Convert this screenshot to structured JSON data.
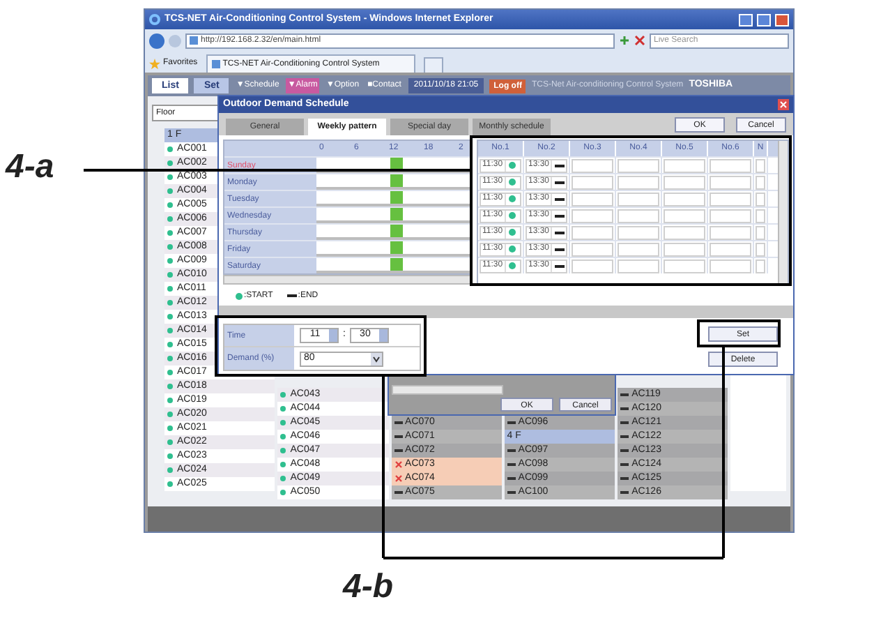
{
  "browser": {
    "title": "TCS-NET Air-Conditioning Control System - Windows Internet Explorer",
    "address": "http://192.168.2.32/en/main.html",
    "search_placeholder": "Live Search",
    "favorites": "Favorites",
    "tab": "TCS-NET Air-Conditioning Control System"
  },
  "app_nav": {
    "tabs": [
      {
        "label": "List",
        "selected": true
      },
      {
        "label": "Set",
        "selected": false
      }
    ],
    "menus": [
      {
        "label": "▼Schedule",
        "highlighted": false
      },
      {
        "label": "▼Alarm",
        "highlighted": true
      },
      {
        "label": "▼Option",
        "highlighted": false
      },
      {
        "label": "■Contact",
        "highlighted": false
      }
    ],
    "datetime": "2011/10/18 21:05",
    "logoff": "Log off",
    "system_name": "TCS-Net Air-conditioning Control System",
    "brand": "TOSHIBA"
  },
  "floor_field": {
    "value": "Floor"
  },
  "unit_columns": [
    {
      "items": [
        {
          "kind": "header",
          "label": "1 F"
        },
        {
          "kind": "running",
          "label": "AC001"
        },
        {
          "kind": "running",
          "label": "AC002"
        },
        {
          "kind": "running",
          "label": "AC003"
        },
        {
          "kind": "running",
          "label": "AC004"
        },
        {
          "kind": "running",
          "label": "AC005"
        },
        {
          "kind": "running",
          "label": "AC006"
        },
        {
          "kind": "running",
          "label": "AC007"
        },
        {
          "kind": "running",
          "label": "AC008"
        },
        {
          "kind": "running",
          "label": "AC009"
        },
        {
          "kind": "running",
          "label": "AC010"
        },
        {
          "kind": "running",
          "label": "AC011"
        },
        {
          "kind": "running",
          "label": "AC012"
        },
        {
          "kind": "running",
          "label": "AC013"
        },
        {
          "kind": "running",
          "label": "AC014"
        },
        {
          "kind": "running",
          "label": "AC015"
        },
        {
          "kind": "running",
          "label": "AC016"
        },
        {
          "kind": "running",
          "label": "AC017"
        },
        {
          "kind": "running",
          "label": "AC018"
        },
        {
          "kind": "running",
          "label": "AC019"
        },
        {
          "kind": "running",
          "label": "AC020"
        },
        {
          "kind": "running",
          "label": "AC021"
        },
        {
          "kind": "running",
          "label": "AC022"
        },
        {
          "kind": "running",
          "label": "AC023"
        },
        {
          "kind": "running",
          "label": "AC024"
        },
        {
          "kind": "running",
          "label": "AC025"
        }
      ]
    },
    {
      "items": [
        {
          "kind": "running",
          "label": "AC043"
        },
        {
          "kind": "running",
          "label": "AC044"
        },
        {
          "kind": "running",
          "label": "AC045"
        },
        {
          "kind": "running",
          "label": "AC046"
        },
        {
          "kind": "running",
          "label": "AC047"
        },
        {
          "kind": "running",
          "label": "AC048"
        },
        {
          "kind": "running",
          "label": "AC049"
        },
        {
          "kind": "running",
          "label": "AC050"
        }
      ]
    },
    {
      "items": [
        {
          "kind": "stopped",
          "label": "AC070"
        },
        {
          "kind": "stopped",
          "label": "AC071"
        },
        {
          "kind": "stopped",
          "label": "AC072"
        },
        {
          "kind": "fault",
          "label": "AC073"
        },
        {
          "kind": "fault",
          "label": "AC074"
        },
        {
          "kind": "stopped",
          "label": "AC075"
        }
      ]
    },
    {
      "items": [
        {
          "kind": "stopped",
          "label": "AC096"
        },
        {
          "kind": "header",
          "label": "4 F"
        },
        {
          "kind": "stopped",
          "label": "AC097"
        },
        {
          "kind": "stopped",
          "label": "AC098"
        },
        {
          "kind": "stopped",
          "label": "AC099"
        },
        {
          "kind": "stopped",
          "label": "AC100"
        }
      ]
    },
    {
      "items": [
        {
          "kind": "stopped",
          "label": "AC119"
        },
        {
          "kind": "stopped",
          "label": "AC120"
        },
        {
          "kind": "stopped",
          "label": "AC121"
        },
        {
          "kind": "stopped",
          "label": "AC122"
        },
        {
          "kind": "stopped",
          "label": "AC123"
        },
        {
          "kind": "stopped",
          "label": "AC124"
        },
        {
          "kind": "stopped",
          "label": "AC125"
        },
        {
          "kind": "stopped",
          "label": "AC126"
        }
      ]
    }
  ],
  "mini_dialog": {
    "buttons": [
      "OK",
      "Cancel"
    ]
  },
  "dialog": {
    "title": "Outdoor Demand Schedule",
    "tabs": [
      {
        "label": "General",
        "selected": false
      },
      {
        "label": "Weekly pattern",
        "selected": true
      },
      {
        "label": "Special day",
        "selected": false
      },
      {
        "label": "Monthly schedule",
        "selected": false
      }
    ],
    "buttons": [
      "OK",
      "Cancel"
    ],
    "hour_ticks": [
      "0",
      "6",
      "12",
      "18",
      "2"
    ],
    "days": [
      {
        "label": "Sunday",
        "color": "#e0506a"
      },
      {
        "label": "Monday",
        "color": "#4a5c9c"
      },
      {
        "label": "Tuesday",
        "color": "#4a5c9c"
      },
      {
        "label": "Wednesday",
        "color": "#4a5c9c"
      },
      {
        "label": "Thursday",
        "color": "#4a5c9c"
      },
      {
        "label": "Friday",
        "color": "#4a5c9c"
      },
      {
        "label": "Saturday",
        "color": "#4a5c9c"
      }
    ],
    "slot_columns": [
      "No.1",
      "No.2",
      "No.3",
      "No.4",
      "No.5",
      "No.6",
      "N"
    ],
    "slot_rows": [
      [
        {
          "time": "11:30",
          "kind": "start"
        },
        {
          "time": "13:30",
          "kind": "end"
        }
      ],
      [
        {
          "time": "11:30",
          "kind": "start"
        },
        {
          "time": "13:30",
          "kind": "end"
        }
      ],
      [
        {
          "time": "11:30",
          "kind": "start"
        },
        {
          "time": "13:30",
          "kind": "end"
        }
      ],
      [
        {
          "time": "11:30",
          "kind": "start"
        },
        {
          "time": "13:30",
          "kind": "end"
        }
      ],
      [
        {
          "time": "11:30",
          "kind": "start"
        },
        {
          "time": "13:30",
          "kind": "end"
        }
      ],
      [
        {
          "time": "11:30",
          "kind": "start"
        },
        {
          "time": "13:30",
          "kind": "end"
        }
      ],
      [
        {
          "time": "11:30",
          "kind": "start"
        },
        {
          "time": "13:30",
          "kind": "end"
        }
      ]
    ],
    "legend": [
      {
        "kind": "start",
        "label": ":START"
      },
      {
        "kind": "end",
        "label": ":END"
      }
    ],
    "form": {
      "time_label": "Time",
      "hour": "11",
      "separator": ":",
      "minute": "30",
      "demand_label": "Demand (%)",
      "demand": "80"
    },
    "side_buttons": [
      "Set",
      "Delete"
    ]
  },
  "annotations": [
    {
      "label": "4-a"
    },
    {
      "label": "4-b"
    }
  ]
}
